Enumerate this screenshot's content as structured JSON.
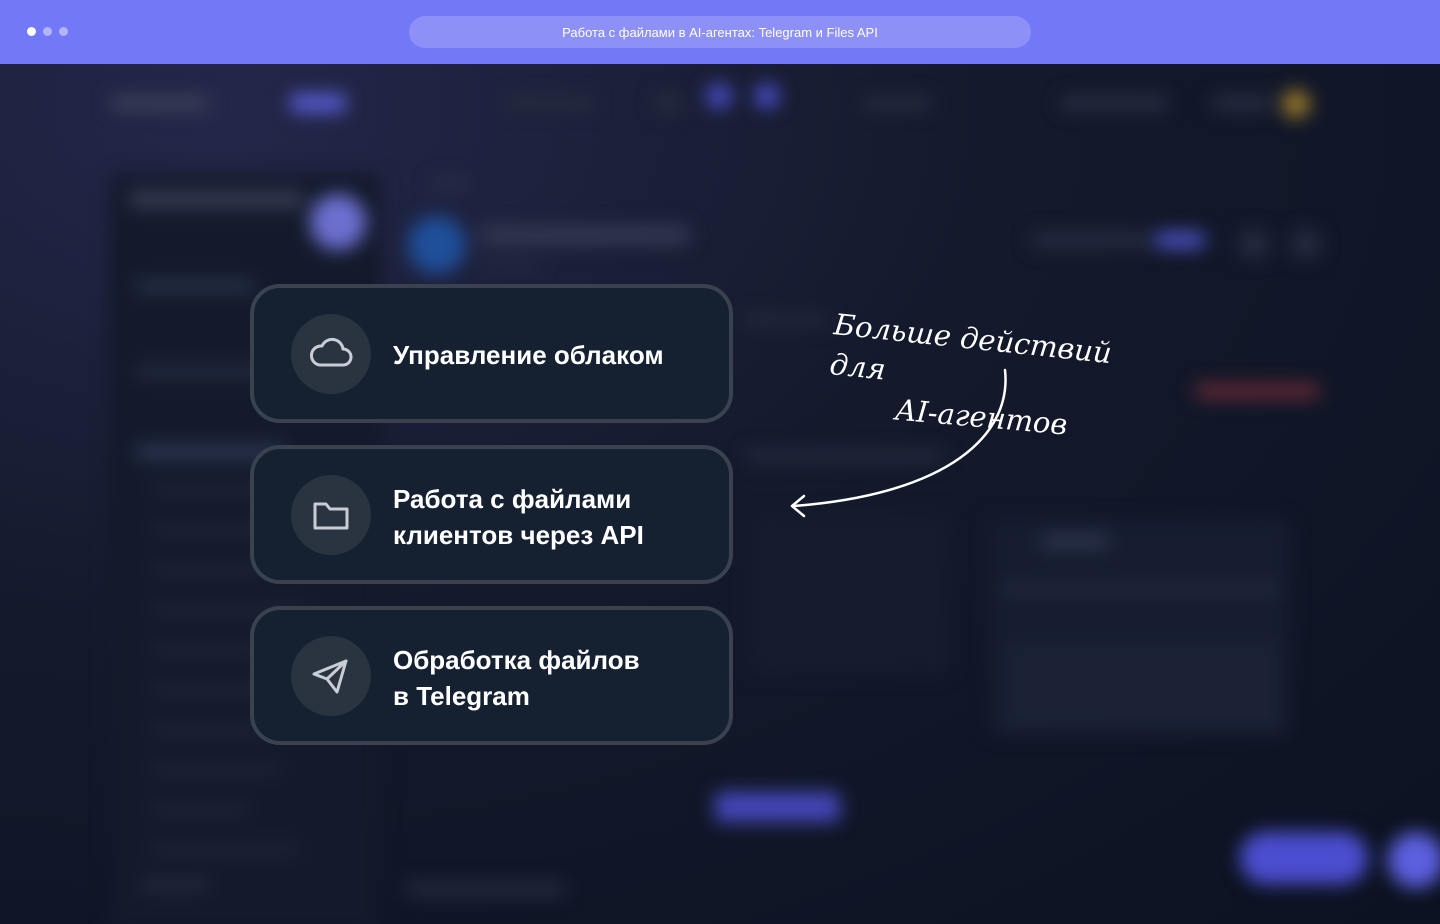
{
  "window": {
    "title": "Работа с файлами в AI-агентах: Telegram и Files API",
    "dots": [
      "dot-active",
      "dot",
      "dot"
    ]
  },
  "cards": [
    {
      "icon": "cloud-icon",
      "label": "Управление облаком"
    },
    {
      "icon": "folder-icon",
      "label_line1": "Работа с файлами",
      "label_line2": "клиентов через API"
    },
    {
      "icon": "send-icon",
      "label_line1": "Обработка файлов",
      "label_line2": "в Telegram"
    }
  ],
  "callout": {
    "line1": "Больше действий для",
    "line2": "AI-агентов"
  },
  "colors": {
    "window_bar": "#7378f6",
    "card_bg": "#152030",
    "card_border": "#3a4250",
    "icon_circle": "#2a3340",
    "page_bg": "#0d1322"
  }
}
